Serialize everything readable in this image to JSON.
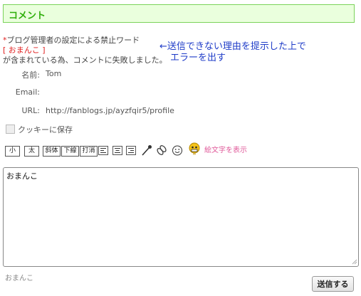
{
  "header": {
    "title": "コメント"
  },
  "error": {
    "line1_star": "*",
    "line1": "ブログ管理者の設定による禁止ワード",
    "line2_open": "[ ",
    "line2_word": "おまんこ",
    "line2_close": " ]",
    "line3": "が含まれている為、コメントに失敗しました。"
  },
  "annotation": {
    "line1": "←送信できない理由を提示した上で",
    "line2": "エラーを出す"
  },
  "form": {
    "name_label": "名前:",
    "name_value": "Tom",
    "email_label": "Email:",
    "email_value": "",
    "url_label": "URL:",
    "url_value": "http://fanblogs.jp/ayzfqir5/profile",
    "cookie_label": "クッキーに保存"
  },
  "toolbar": {
    "small": "小",
    "bold": "太",
    "italic": "斜体",
    "underline": "下線",
    "strike": "打消",
    "emoji_link": "絵文字を表示"
  },
  "comment": {
    "text": "おまんこ",
    "preview": "おまんこ",
    "submit_label": "送信する"
  }
}
